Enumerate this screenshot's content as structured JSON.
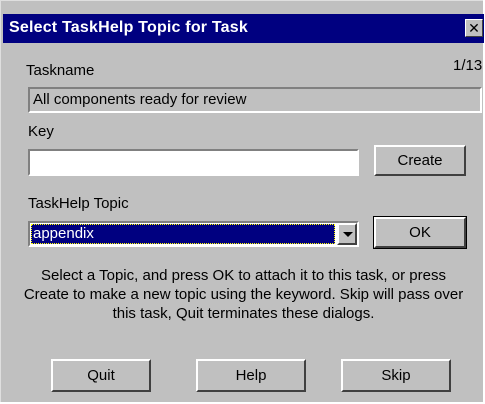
{
  "dialog": {
    "title": "Select TaskHelp Topic for Task",
    "close_glyph": "✕"
  },
  "taskname": {
    "label": "Taskname",
    "counter": "1/13",
    "value": "All components ready for review"
  },
  "key": {
    "label": "Key",
    "value": "",
    "placeholder": "",
    "create_label": "Create"
  },
  "topic": {
    "label": "TaskHelp Topic",
    "selected": "appendix",
    "ok_label": "OK"
  },
  "help_text": "Select a Topic, and press OK to attach it to this task, or press Create to make a new topic using the keyword. Skip will pass over this task, Quit terminates these dialogs.",
  "footer": {
    "quit_label": "Quit",
    "help_label": "Help",
    "skip_label": "Skip"
  },
  "colors": {
    "titlebar": "#000080",
    "face": "#c0c0c0",
    "selection": "#000080"
  },
  "icons": {
    "close": "close-icon",
    "dropdown": "chevron-down-icon"
  }
}
